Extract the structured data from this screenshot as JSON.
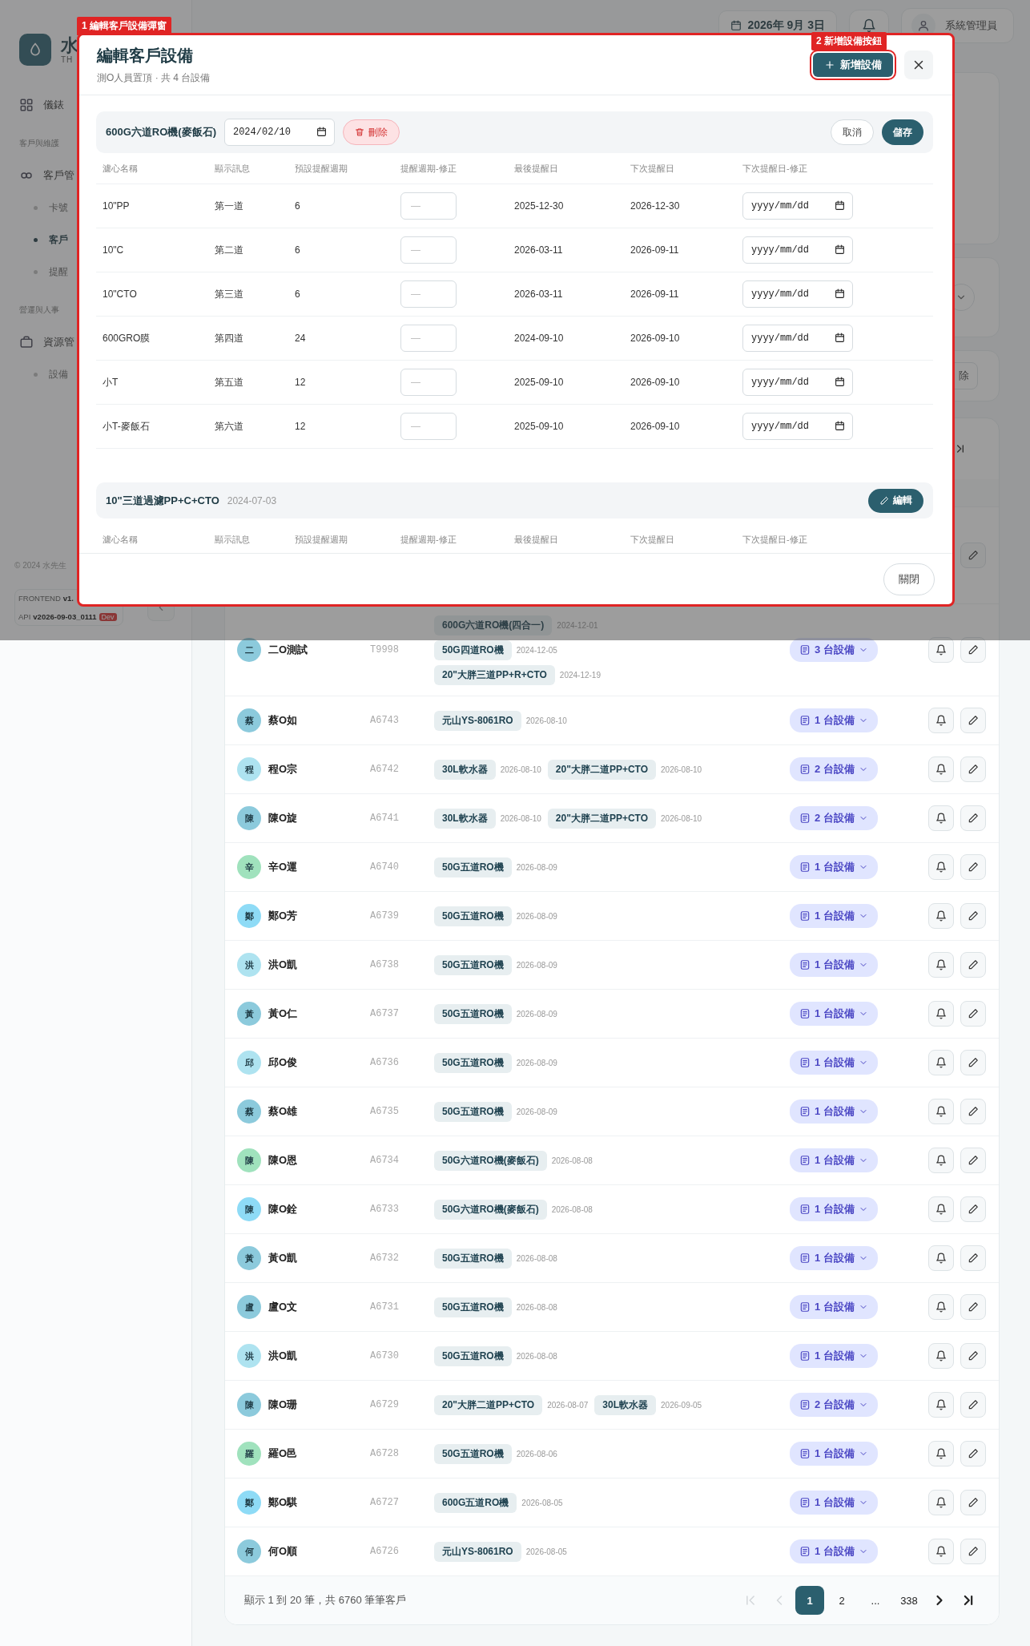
{
  "annotations": [
    {
      "label": "1 編輯客戶設備彈窗"
    },
    {
      "label": "2 新增設備按鈕"
    }
  ],
  "sidebar": {
    "logo_text": "水",
    "logo_subtitle": "TH",
    "items": [
      {
        "kind": "link",
        "label": "儀錶"
      },
      {
        "kind": "section",
        "label": "客戶與維護"
      },
      {
        "kind": "link",
        "label": "客戶管"
      },
      {
        "kind": "sub",
        "label": "卡號",
        "selected": false
      },
      {
        "kind": "sub",
        "label": "客戶",
        "selected": true
      },
      {
        "kind": "sub",
        "label": "提醒",
        "selected": false
      },
      {
        "kind": "section",
        "label": "營運與人事"
      },
      {
        "kind": "link",
        "label": "資源管"
      },
      {
        "kind": "sub",
        "label": "設備",
        "selected": false
      }
    ],
    "copyright": "© 2024 水先生",
    "versions": [
      {
        "label": "FRONTEND",
        "value": "v1."
      },
      {
        "label": "API",
        "value": "v2026-09-03_0111",
        "badge": "Dev"
      }
    ]
  },
  "topbar": {
    "date": "2026年 9月 3日",
    "user": "系統管理員"
  },
  "background": {
    "delete_fragment": "除"
  },
  "modal": {
    "title": "編輯客戶設備",
    "subtitle": "測O人員置頂 · 共 4 台設備",
    "add_button": "新增設備",
    "close_button": "關閉",
    "devices": [
      {
        "name": "600G六道RO機(麥飯石)",
        "date": "2024/02/10",
        "expanded": true,
        "delete_button": "刪除",
        "cancel_button": "取消",
        "save_button": "儲存",
        "columns": [
          "濾心名稱",
          "顯示訊息",
          "預設提醒週期",
          "提醒週期-修正",
          "最後提醒日",
          "下次提醒日",
          "下次提醒日-修正"
        ],
        "filters": [
          {
            "name": "10\"PP",
            "label": "第一道",
            "default_cycle": "6",
            "cycle_placeholder": "—",
            "last_date": "2025-12-30",
            "next_date": "2026-12-30",
            "next_placeholder": "yyyy/mm/dd"
          },
          {
            "name": "10\"C",
            "label": "第二道",
            "default_cycle": "6",
            "cycle_placeholder": "—",
            "last_date": "2026-03-11",
            "next_date": "2026-09-11",
            "next_placeholder": "yyyy/mm/dd"
          },
          {
            "name": "10\"CTO",
            "label": "第三道",
            "default_cycle": "6",
            "cycle_placeholder": "—",
            "last_date": "2026-03-11",
            "next_date": "2026-09-11",
            "next_placeholder": "yyyy/mm/dd"
          },
          {
            "name": "600GRO膜",
            "label": "第四道",
            "default_cycle": "24",
            "cycle_placeholder": "—",
            "last_date": "2024-09-10",
            "next_date": "2026-09-10",
            "next_placeholder": "yyyy/mm/dd"
          },
          {
            "name": "小T",
            "label": "第五道",
            "default_cycle": "12",
            "cycle_placeholder": "—",
            "last_date": "2025-09-10",
            "next_date": "2026-09-10",
            "next_placeholder": "yyyy/mm/dd"
          },
          {
            "name": "小T-麥飯石",
            "label": "第六道",
            "default_cycle": "12",
            "cycle_placeholder": "—",
            "last_date": "2025-09-10",
            "next_date": "2026-09-10",
            "next_placeholder": "yyyy/mm/dd"
          }
        ]
      },
      {
        "name": "10\"三道過濾PP+C+CTO",
        "date": "2024-07-03",
        "expanded": false,
        "edit_button": "編輯",
        "columns": [
          "濾心名稱",
          "顯示訊息",
          "預設提醒週期",
          "提醒週期-修正",
          "最後提醒日",
          "下次提醒日",
          "下次提醒日-修正"
        ]
      }
    ]
  },
  "table": {
    "rows": [
      {
        "avatar": "二",
        "name": "二O測試",
        "code": "T9998",
        "color": "#8ccadc",
        "device_count": "3 台設備",
        "devices": [
          {
            "name": "600G六道RO機(四合一)",
            "date": "2024-12-01"
          },
          {
            "name": "50G四道RO機",
            "date": "2024-12-05"
          },
          {
            "name": "20\"大胖三道PP+R+CTO",
            "date": "2024-12-19"
          }
        ]
      },
      {
        "avatar": "蔡",
        "name": "蔡O如",
        "code": "A6743",
        "color": "#8ccadc",
        "device_count": "1 台設備",
        "devices": [
          {
            "name": "元山YS-8061RO",
            "date": "2026-08-10"
          }
        ]
      },
      {
        "avatar": "程",
        "name": "程O宗",
        "code": "A6742",
        "color": "#aee3f0",
        "device_count": "2 台設備",
        "devices": [
          {
            "name": "30L軟水器",
            "date": "2026-08-10"
          },
          {
            "name": "20\"大胖二道PP+CTO",
            "date": "2026-08-10"
          }
        ]
      },
      {
        "avatar": "陳",
        "name": "陳O旋",
        "code": "A6741",
        "color": "#8ccadc",
        "device_count": "2 台設備",
        "devices": [
          {
            "name": "30L軟水器",
            "date": "2026-08-10"
          },
          {
            "name": "20\"大胖二道PP+CTO",
            "date": "2026-08-10"
          }
        ]
      },
      {
        "avatar": "辛",
        "name": "辛O運",
        "code": "A6740",
        "color": "#a0e2bd",
        "device_count": "1 台設備",
        "devices": [
          {
            "name": "50G五道RO機",
            "date": "2026-08-09"
          }
        ]
      },
      {
        "avatar": "鄭",
        "name": "鄭O芳",
        "code": "A6739",
        "color": "#8edbf6",
        "device_count": "1 台設備",
        "devices": [
          {
            "name": "50G五道RO機",
            "date": "2026-08-09"
          }
        ]
      },
      {
        "avatar": "洪",
        "name": "洪O凱",
        "code": "A6738",
        "color": "#aee3f0",
        "device_count": "1 台設備",
        "devices": [
          {
            "name": "50G五道RO機",
            "date": "2026-08-09"
          }
        ]
      },
      {
        "avatar": "黃",
        "name": "黃O仁",
        "code": "A6737",
        "color": "#8ccadc",
        "device_count": "1 台設備",
        "devices": [
          {
            "name": "50G五道RO機",
            "date": "2026-08-09"
          }
        ]
      },
      {
        "avatar": "邱",
        "name": "邱O俊",
        "code": "A6736",
        "color": "#aee3f0",
        "device_count": "1 台設備",
        "devices": [
          {
            "name": "50G五道RO機",
            "date": "2026-08-09"
          }
        ]
      },
      {
        "avatar": "蔡",
        "name": "蔡O雄",
        "code": "A6735",
        "color": "#8ccadc",
        "device_count": "1 台設備",
        "devices": [
          {
            "name": "50G五道RO機",
            "date": "2026-08-09"
          }
        ]
      },
      {
        "avatar": "陳",
        "name": "陳O恩",
        "code": "A6734",
        "color": "#a0e2bd",
        "device_count": "1 台設備",
        "devices": [
          {
            "name": "50G六道RO機(麥飯石)",
            "date": "2026-08-08"
          }
        ]
      },
      {
        "avatar": "陳",
        "name": "陳O銓",
        "code": "A6733",
        "color": "#8edbf6",
        "device_count": "1 台設備",
        "devices": [
          {
            "name": "50G六道RO機(麥飯石)",
            "date": "2026-08-08"
          }
        ]
      },
      {
        "avatar": "黃",
        "name": "黃O凱",
        "code": "A6732",
        "color": "#8ccadc",
        "device_count": "1 台設備",
        "devices": [
          {
            "name": "50G五道RO機",
            "date": "2026-08-08"
          }
        ]
      },
      {
        "avatar": "盧",
        "name": "盧O文",
        "code": "A6731",
        "color": "#8ccadc",
        "device_count": "1 台設備",
        "devices": [
          {
            "name": "50G五道RO機",
            "date": "2026-08-08"
          }
        ]
      },
      {
        "avatar": "洪",
        "name": "洪O凱",
        "code": "A6730",
        "color": "#aee3f0",
        "device_count": "1 台設備",
        "devices": [
          {
            "name": "50G五道RO機",
            "date": "2026-08-08"
          }
        ]
      },
      {
        "avatar": "陳",
        "name": "陳O珊",
        "code": "A6729",
        "color": "#8ccadc",
        "device_count": "2 台設備",
        "devices": [
          {
            "name": "20\"大胖二道PP+CTO",
            "date": "2026-08-07"
          },
          {
            "name": "30L軟水器",
            "date": "2026-09-05"
          }
        ]
      },
      {
        "avatar": "羅",
        "name": "羅O邑",
        "code": "A6728",
        "color": "#a0e2bd",
        "device_count": "1 台設備",
        "devices": [
          {
            "name": "50G五道RO機",
            "date": "2026-08-06"
          }
        ]
      },
      {
        "avatar": "鄭",
        "name": "鄭O騏",
        "code": "A6727",
        "color": "#8edbf6",
        "device_count": "1 台設備",
        "devices": [
          {
            "name": "600G五道RO機",
            "date": "2026-08-05"
          }
        ]
      },
      {
        "avatar": "何",
        "name": "何O順",
        "code": "A6726",
        "color": "#8ccadc",
        "device_count": "1 台設備",
        "devices": [
          {
            "name": "元山YS-8061RO",
            "date": "2026-08-05"
          }
        ]
      }
    ],
    "summary": "顯示 1 到 20 筆，共 6760 筆筆客戶",
    "pagination": [
      {
        "kind": "first",
        "disabled": true
      },
      {
        "kind": "prev",
        "disabled": true
      },
      {
        "kind": "page",
        "label": "1",
        "selected": true
      },
      {
        "kind": "page",
        "label": "2",
        "selected": false
      },
      {
        "kind": "ellipsis",
        "label": "..."
      },
      {
        "kind": "page",
        "label": "338",
        "selected": false
      },
      {
        "kind": "next",
        "disabled": false
      },
      {
        "kind": "last",
        "disabled": false
      }
    ]
  }
}
